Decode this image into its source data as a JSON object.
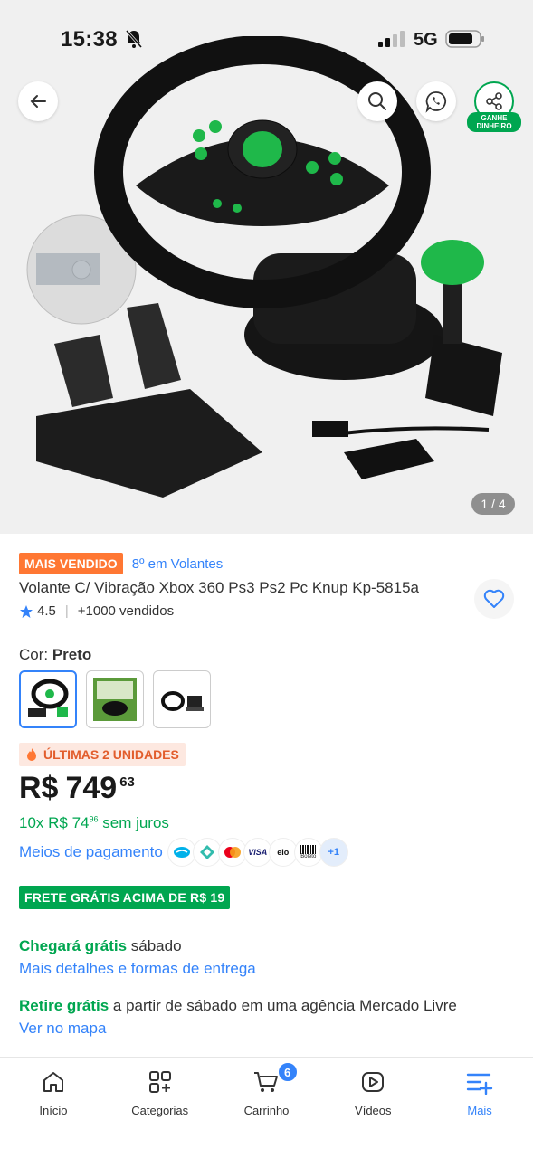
{
  "status_bar": {
    "time": "15:38",
    "network": "5G"
  },
  "gallery": {
    "pager": "1 / 4",
    "share_badge": "GANHE DINHEIRO"
  },
  "product": {
    "badge": "MAIS VENDIDO",
    "rank": "8º em Volantes",
    "title": "Volante C/ Vibração Xbox 360 Ps3 Ps2 Pc Knup Kp-5815a",
    "rating": "4.5",
    "sold": "+1000 vendidos",
    "color_label": "Cor: ",
    "color_value": "Preto",
    "stock": "ÚLTIMAS 2 UNIDADES",
    "price_currency": "R$",
    "price_main": "749",
    "price_cents": "63",
    "install_prefix": "10x R$ 74",
    "install_cents": "96",
    "install_suffix": " sem juros",
    "payment_link": "Meios de pagamento",
    "payment_icons": [
      "mercado-pago-icon",
      "pix-icon",
      "mastercard-icon",
      "visa-icon",
      "elo-icon",
      "boleto-icon"
    ],
    "payment_labels": {
      "visa": "VISA",
      "elo": "elo",
      "boleto": "Boleto",
      "more": "+1"
    },
    "free_shipping": "FRETE GRÁTIS ACIMA DE R$ 19",
    "ship_free_label": "Chegará grátis",
    "ship_free_day": " sábado",
    "ship_details_link": "Mais detalhes e formas de entrega",
    "pickup_label": "Retire grátis",
    "pickup_text": " a partir de sábado em uma agência Mercado Livre",
    "map_link": "Ver no mapa"
  },
  "bottom_nav": {
    "items": [
      {
        "label": "Início",
        "icon": "home-icon"
      },
      {
        "label": "Categorias",
        "icon": "categories-icon"
      },
      {
        "label": "Carrinho",
        "icon": "cart-icon",
        "badge": "6"
      },
      {
        "label": "Vídeos",
        "icon": "video-icon"
      },
      {
        "label": "Mais",
        "icon": "menu-icon",
        "active": true
      }
    ]
  },
  "colors": {
    "accent": "#3483fa",
    "green": "#00a650",
    "orange": "#ff7733"
  }
}
